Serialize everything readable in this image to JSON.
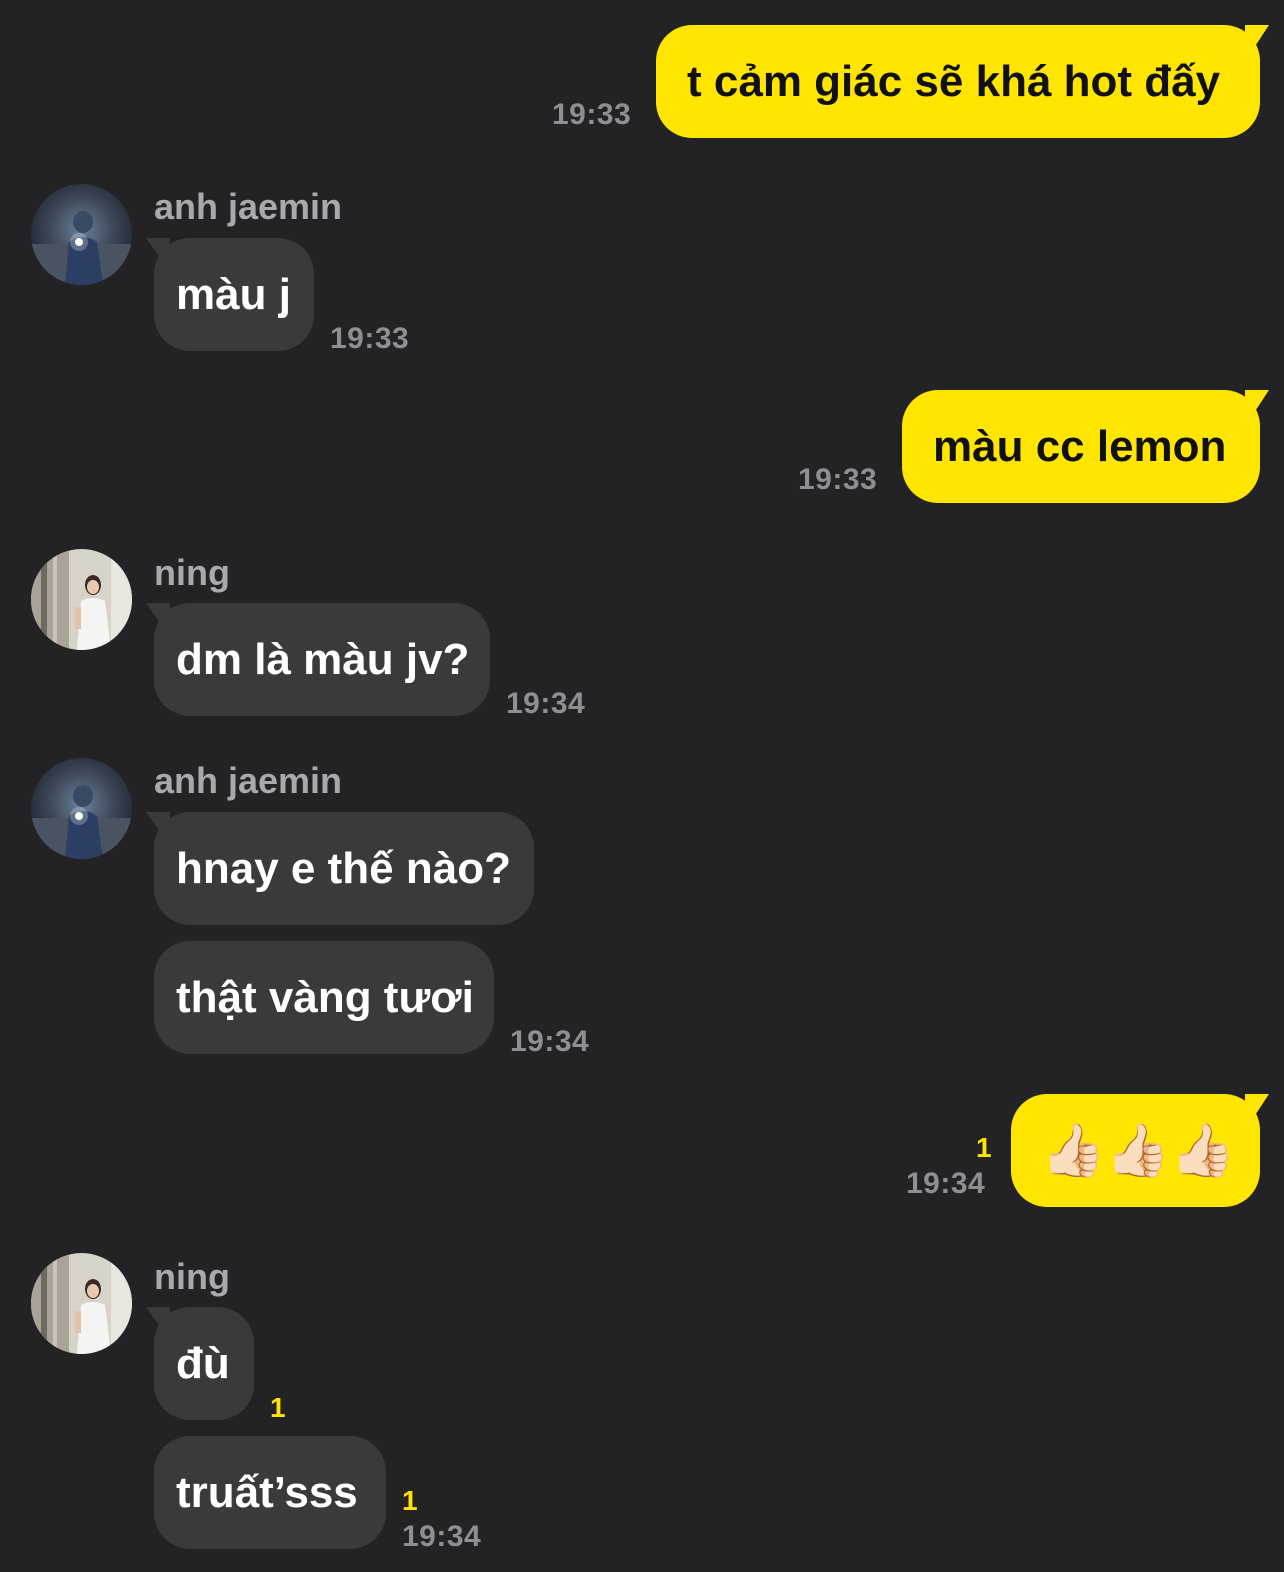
{
  "theme": {
    "background": "#232325",
    "outgoing_bubble": "#ffe500",
    "incoming_bubble": "#3a3a3c",
    "unread_color": "#ffe500"
  },
  "contacts": {
    "jaemin": {
      "name": "anh jaemin",
      "avatar_icon": "avatar-photo-jaemin"
    },
    "ning": {
      "name": "ning",
      "avatar_icon": "avatar-photo-ning"
    }
  },
  "messages": [
    {
      "dir": "out",
      "text": "t cảm giác sẽ khá hot đấy",
      "time": "19:33"
    },
    {
      "dir": "in",
      "sender": "anh jaemin",
      "text": "màu j",
      "time": "19:33"
    },
    {
      "dir": "out",
      "text": "màu cc lemon",
      "time": "19:33"
    },
    {
      "dir": "in",
      "sender": "ning",
      "text": "dm là màu jv?",
      "time": "19:34"
    },
    {
      "dir": "in",
      "sender": "anh jaemin",
      "text": "hnay e thế nào?"
    },
    {
      "dir": "in",
      "text": "thật vàng tươi",
      "time": "19:34"
    },
    {
      "dir": "out",
      "text": "👍🏻👍🏻👍🏻",
      "icons": [
        "thumbs-up-icon",
        "thumbs-up-icon",
        "thumbs-up-icon"
      ],
      "unread": "1",
      "time": "19:34"
    },
    {
      "dir": "in",
      "sender": "ning",
      "text": "đù",
      "unread": "1"
    },
    {
      "dir": "in",
      "text": "truất’sss",
      "unread": "1",
      "time": "19:34"
    }
  ]
}
